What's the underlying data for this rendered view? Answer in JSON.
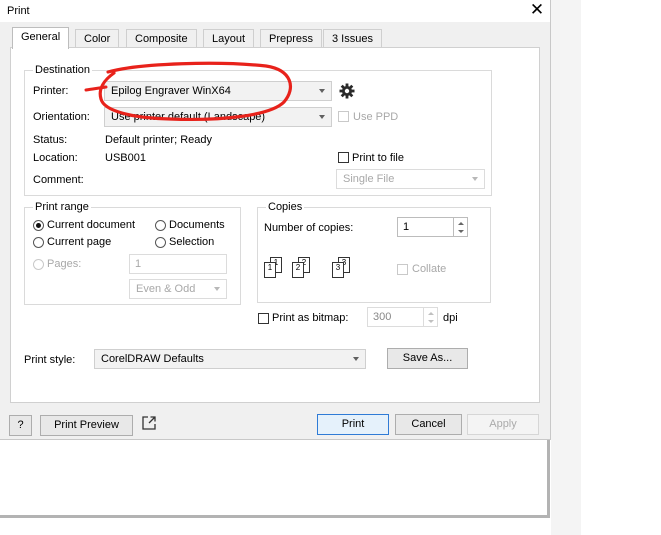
{
  "window": {
    "title": "Print",
    "close_glyph": "✕"
  },
  "tabs": [
    {
      "label": "General",
      "active": true
    },
    {
      "label": "Color"
    },
    {
      "label": "Composite"
    },
    {
      "label": "Layout"
    },
    {
      "label": "Prepress"
    },
    {
      "label": "3 Issues"
    }
  ],
  "destination": {
    "legend": "Destination",
    "printer_label": "Printer:",
    "printer_value": "Epilog Engraver WinX64",
    "orientation_label": "Orientation:",
    "orientation_value": "Use printer default (Landscape)",
    "use_ppd_label": "Use PPD",
    "status_label": "Status:",
    "status_value": "Default printer; Ready",
    "location_label": "Location:",
    "location_value": "USB001",
    "comment_label": "Comment:",
    "print_to_file_label": "Print to file",
    "file_mode_value": "Single File"
  },
  "print_range": {
    "legend": "Print range",
    "current_document": "Current document",
    "documents": "Documents",
    "current_page": "Current page",
    "selection": "Selection",
    "pages_label": "Pages:",
    "pages_value": "1",
    "even_odd_value": "Even & Odd"
  },
  "copies": {
    "legend": "Copies",
    "number_label": "Number of copies:",
    "number_value": "1",
    "collate_label": "Collate",
    "page_icon_numbers": [
      "1",
      "1",
      "2",
      "2",
      "3",
      "3"
    ]
  },
  "bitmap": {
    "label": "Print as bitmap:",
    "dpi_value": "300",
    "dpi_unit": "dpi"
  },
  "print_style": {
    "label": "Print style:",
    "value": "CorelDRAW Defaults",
    "save_as_label": "Save As..."
  },
  "footer": {
    "help_label": "?",
    "print_preview_label": "Print Preview",
    "print_label": "Print",
    "cancel_label": "Cancel",
    "apply_label": "Apply"
  },
  "annotation": {
    "color": "#e8221b",
    "shape": "hand-drawn-circle"
  },
  "colors": {
    "accent": "#2f7bd6",
    "disabled": "#a8a8a8"
  }
}
